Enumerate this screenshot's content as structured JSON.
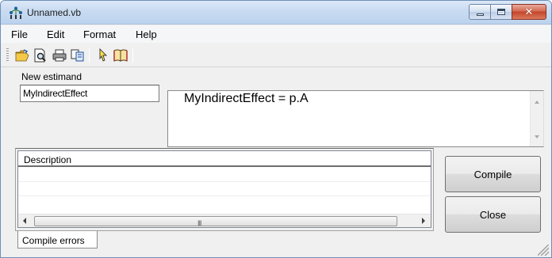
{
  "window": {
    "title": "Unnamed.vb",
    "close_glyph": "✕"
  },
  "menu": {
    "items": [
      "File",
      "Edit",
      "Format",
      "Help"
    ]
  },
  "toolbar": {
    "buttons": [
      "open-folder-icon",
      "print-preview-icon",
      "print-icon",
      "copy-icon",
      "help-arrow-icon",
      "book-icon"
    ]
  },
  "estimand": {
    "label": "New estimand",
    "name_value": "MyIndirectEffect"
  },
  "editor": {
    "text": "MyIndirectEffect = p.A"
  },
  "errors": {
    "column_header": "Description",
    "scroll_grip": "III",
    "tab_label": "Compile errors"
  },
  "buttons": {
    "compile": "Compile",
    "close": "Close"
  }
}
